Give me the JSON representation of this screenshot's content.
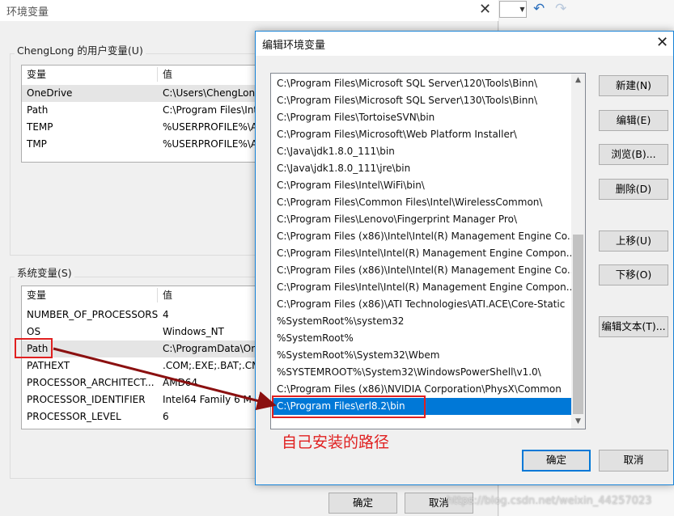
{
  "background_window": {
    "title": "环境变量",
    "close_glyph": "✕",
    "user_vars": {
      "group_label": "ChengLong 的用户变量(U)",
      "col_name": "变量",
      "col_value": "值",
      "rows": [
        {
          "name": "OneDrive",
          "value": "C:\\Users\\ChengLon"
        },
        {
          "name": "Path",
          "value": "C:\\Program Files\\Int"
        },
        {
          "name": "TEMP",
          "value": "%USERPROFILE%\\A"
        },
        {
          "name": "TMP",
          "value": "%USERPROFILE%\\A"
        }
      ]
    },
    "sys_vars": {
      "group_label": "系统变量(S)",
      "col_name": "变量",
      "col_value": "值",
      "rows": [
        {
          "name": "NUMBER_OF_PROCESSORS",
          "value": "4"
        },
        {
          "name": "OS",
          "value": "Windows_NT"
        },
        {
          "name": "Path",
          "value": "C:\\ProgramData\\Or"
        },
        {
          "name": "PATHEXT",
          "value": ".COM;.EXE;.BAT;.CM"
        },
        {
          "name": "PROCESSOR_ARCHITECT...",
          "value": "AMD64"
        },
        {
          "name": "PROCESSOR_IDENTIFIER",
          "value": "Intel64 Family 6 M"
        },
        {
          "name": "PROCESSOR_LEVEL",
          "value": "6"
        }
      ]
    },
    "ok_label": "确定",
    "cancel_label": "取消"
  },
  "toolbar": {
    "dropdown_glyph": "▼",
    "undo_glyph": "↶",
    "redo_glyph": "↷"
  },
  "dialog": {
    "title": "编辑环境变量",
    "close_glyph": "✕",
    "paths": [
      "C:\\Program Files\\Microsoft SQL Server\\120\\Tools\\Binn\\",
      "C:\\Program Files\\Microsoft SQL Server\\130\\Tools\\Binn\\",
      "C:\\Program Files\\TortoiseSVN\\bin",
      "C:\\Program Files\\Microsoft\\Web Platform Installer\\",
      "C:\\Java\\jdk1.8.0_111\\bin",
      "C:\\Java\\jdk1.8.0_111\\jre\\bin",
      "C:\\Program Files\\Intel\\WiFi\\bin\\",
      "C:\\Program Files\\Common Files\\Intel\\WirelessCommon\\",
      "C:\\Program Files\\Lenovo\\Fingerprint Manager Pro\\",
      "C:\\Program Files (x86)\\Intel\\Intel(R) Management Engine Co...",
      "C:\\Program Files\\Intel\\Intel(R) Management Engine Compon...",
      "C:\\Program Files (x86)\\Intel\\Intel(R) Management Engine Co...",
      "C:\\Program Files\\Intel\\Intel(R) Management Engine Compon...",
      "C:\\Program Files (x86)\\ATI Technologies\\ATI.ACE\\Core-Static",
      "%SystemRoot%\\system32",
      "%SystemRoot%",
      "%SystemRoot%\\System32\\Wbem",
      "%SYSTEMROOT%\\System32\\WindowsPowerShell\\v1.0\\",
      "C:\\Program Files (x86)\\NVIDIA Corporation\\PhysX\\Common",
      "C:\\Program Files\\erl8.2\\bin"
    ],
    "selected_index": 19,
    "buttons": {
      "new": "新建(N)",
      "edit": "编辑(E)",
      "browse": "浏览(B)...",
      "delete": "删除(D)",
      "move_up": "上移(U)",
      "move_down": "下移(O)",
      "edit_text": "编辑文本(T)..."
    },
    "ok_label": "确定",
    "cancel_label": "取消",
    "scroll_up_glyph": "▲",
    "scroll_down_glyph": "▼"
  },
  "annotation": {
    "note": "自己安装的路径",
    "color": "#e02020"
  },
  "watermark": "https://blog.csdn.net/weixin_44257023"
}
